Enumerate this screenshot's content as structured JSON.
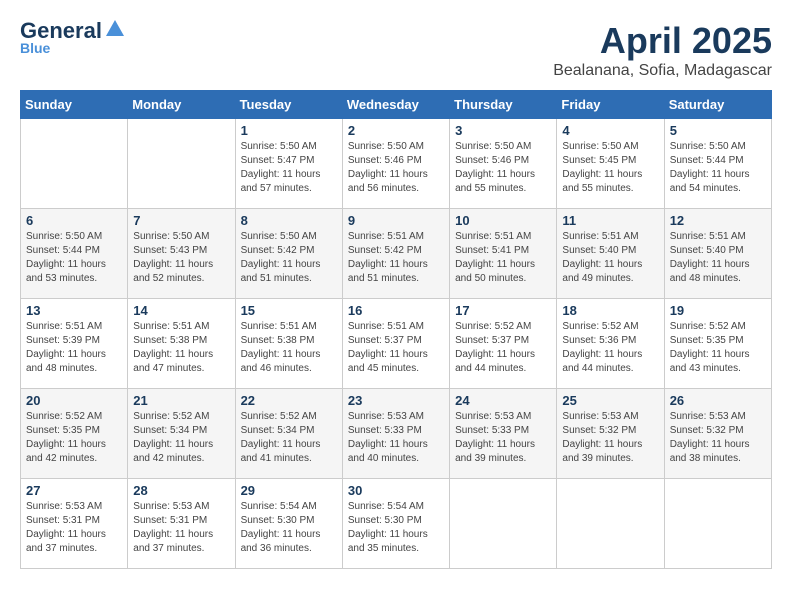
{
  "header": {
    "logo_general": "General",
    "logo_blue": "Blue",
    "month_year": "April 2025",
    "location": "Bealanana, Sofia, Madagascar"
  },
  "weekdays": [
    "Sunday",
    "Monday",
    "Tuesday",
    "Wednesday",
    "Thursday",
    "Friday",
    "Saturday"
  ],
  "weeks": [
    [
      {
        "day": "",
        "sunrise": "",
        "sunset": "",
        "daylight": ""
      },
      {
        "day": "",
        "sunrise": "",
        "sunset": "",
        "daylight": ""
      },
      {
        "day": "1",
        "sunrise": "Sunrise: 5:50 AM",
        "sunset": "Sunset: 5:47 PM",
        "daylight": "Daylight: 11 hours and 57 minutes."
      },
      {
        "day": "2",
        "sunrise": "Sunrise: 5:50 AM",
        "sunset": "Sunset: 5:46 PM",
        "daylight": "Daylight: 11 hours and 56 minutes."
      },
      {
        "day": "3",
        "sunrise": "Sunrise: 5:50 AM",
        "sunset": "Sunset: 5:46 PM",
        "daylight": "Daylight: 11 hours and 55 minutes."
      },
      {
        "day": "4",
        "sunrise": "Sunrise: 5:50 AM",
        "sunset": "Sunset: 5:45 PM",
        "daylight": "Daylight: 11 hours and 55 minutes."
      },
      {
        "day": "5",
        "sunrise": "Sunrise: 5:50 AM",
        "sunset": "Sunset: 5:44 PM",
        "daylight": "Daylight: 11 hours and 54 minutes."
      }
    ],
    [
      {
        "day": "6",
        "sunrise": "Sunrise: 5:50 AM",
        "sunset": "Sunset: 5:44 PM",
        "daylight": "Daylight: 11 hours and 53 minutes."
      },
      {
        "day": "7",
        "sunrise": "Sunrise: 5:50 AM",
        "sunset": "Sunset: 5:43 PM",
        "daylight": "Daylight: 11 hours and 52 minutes."
      },
      {
        "day": "8",
        "sunrise": "Sunrise: 5:50 AM",
        "sunset": "Sunset: 5:42 PM",
        "daylight": "Daylight: 11 hours and 51 minutes."
      },
      {
        "day": "9",
        "sunrise": "Sunrise: 5:51 AM",
        "sunset": "Sunset: 5:42 PM",
        "daylight": "Daylight: 11 hours and 51 minutes."
      },
      {
        "day": "10",
        "sunrise": "Sunrise: 5:51 AM",
        "sunset": "Sunset: 5:41 PM",
        "daylight": "Daylight: 11 hours and 50 minutes."
      },
      {
        "day": "11",
        "sunrise": "Sunrise: 5:51 AM",
        "sunset": "Sunset: 5:40 PM",
        "daylight": "Daylight: 11 hours and 49 minutes."
      },
      {
        "day": "12",
        "sunrise": "Sunrise: 5:51 AM",
        "sunset": "Sunset: 5:40 PM",
        "daylight": "Daylight: 11 hours and 48 minutes."
      }
    ],
    [
      {
        "day": "13",
        "sunrise": "Sunrise: 5:51 AM",
        "sunset": "Sunset: 5:39 PM",
        "daylight": "Daylight: 11 hours and 48 minutes."
      },
      {
        "day": "14",
        "sunrise": "Sunrise: 5:51 AM",
        "sunset": "Sunset: 5:38 PM",
        "daylight": "Daylight: 11 hours and 47 minutes."
      },
      {
        "day": "15",
        "sunrise": "Sunrise: 5:51 AM",
        "sunset": "Sunset: 5:38 PM",
        "daylight": "Daylight: 11 hours and 46 minutes."
      },
      {
        "day": "16",
        "sunrise": "Sunrise: 5:51 AM",
        "sunset": "Sunset: 5:37 PM",
        "daylight": "Daylight: 11 hours and 45 minutes."
      },
      {
        "day": "17",
        "sunrise": "Sunrise: 5:52 AM",
        "sunset": "Sunset: 5:37 PM",
        "daylight": "Daylight: 11 hours and 44 minutes."
      },
      {
        "day": "18",
        "sunrise": "Sunrise: 5:52 AM",
        "sunset": "Sunset: 5:36 PM",
        "daylight": "Daylight: 11 hours and 44 minutes."
      },
      {
        "day": "19",
        "sunrise": "Sunrise: 5:52 AM",
        "sunset": "Sunset: 5:35 PM",
        "daylight": "Daylight: 11 hours and 43 minutes."
      }
    ],
    [
      {
        "day": "20",
        "sunrise": "Sunrise: 5:52 AM",
        "sunset": "Sunset: 5:35 PM",
        "daylight": "Daylight: 11 hours and 42 minutes."
      },
      {
        "day": "21",
        "sunrise": "Sunrise: 5:52 AM",
        "sunset": "Sunset: 5:34 PM",
        "daylight": "Daylight: 11 hours and 42 minutes."
      },
      {
        "day": "22",
        "sunrise": "Sunrise: 5:52 AM",
        "sunset": "Sunset: 5:34 PM",
        "daylight": "Daylight: 11 hours and 41 minutes."
      },
      {
        "day": "23",
        "sunrise": "Sunrise: 5:53 AM",
        "sunset": "Sunset: 5:33 PM",
        "daylight": "Daylight: 11 hours and 40 minutes."
      },
      {
        "day": "24",
        "sunrise": "Sunrise: 5:53 AM",
        "sunset": "Sunset: 5:33 PM",
        "daylight": "Daylight: 11 hours and 39 minutes."
      },
      {
        "day": "25",
        "sunrise": "Sunrise: 5:53 AM",
        "sunset": "Sunset: 5:32 PM",
        "daylight": "Daylight: 11 hours and 39 minutes."
      },
      {
        "day": "26",
        "sunrise": "Sunrise: 5:53 AM",
        "sunset": "Sunset: 5:32 PM",
        "daylight": "Daylight: 11 hours and 38 minutes."
      }
    ],
    [
      {
        "day": "27",
        "sunrise": "Sunrise: 5:53 AM",
        "sunset": "Sunset: 5:31 PM",
        "daylight": "Daylight: 11 hours and 37 minutes."
      },
      {
        "day": "28",
        "sunrise": "Sunrise: 5:53 AM",
        "sunset": "Sunset: 5:31 PM",
        "daylight": "Daylight: 11 hours and 37 minutes."
      },
      {
        "day": "29",
        "sunrise": "Sunrise: 5:54 AM",
        "sunset": "Sunset: 5:30 PM",
        "daylight": "Daylight: 11 hours and 36 minutes."
      },
      {
        "day": "30",
        "sunrise": "Sunrise: 5:54 AM",
        "sunset": "Sunset: 5:30 PM",
        "daylight": "Daylight: 11 hours and 35 minutes."
      },
      {
        "day": "",
        "sunrise": "",
        "sunset": "",
        "daylight": ""
      },
      {
        "day": "",
        "sunrise": "",
        "sunset": "",
        "daylight": ""
      },
      {
        "day": "",
        "sunrise": "",
        "sunset": "",
        "daylight": ""
      }
    ]
  ]
}
